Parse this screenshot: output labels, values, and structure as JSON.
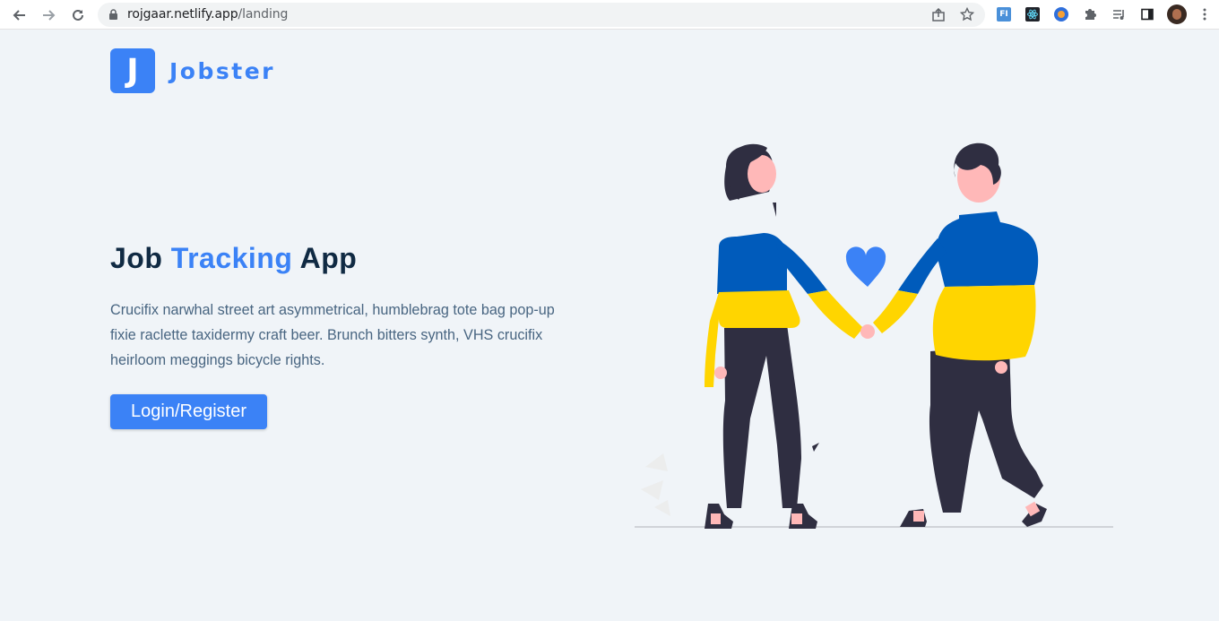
{
  "browser": {
    "url_host": "rojgaar.netlify.app",
    "url_path": "/landing",
    "back_icon": "arrow-left-icon",
    "forward_icon": "arrow-right-icon",
    "reload_icon": "reload-icon",
    "lock_icon": "lock-icon",
    "share_icon": "share-icon",
    "bookmark_icon": "star-icon",
    "extensions": [
      "fi-extension-icon",
      "react-devtools-icon",
      "colorzilla-icon",
      "puzzle-icon",
      "media-icon",
      "sidepanel-icon"
    ],
    "profile_icon": "avatar-icon",
    "menu_icon": "kebab-icon"
  },
  "logo": {
    "letter": "J",
    "name": "Jobster"
  },
  "hero": {
    "title_part1": "Job ",
    "title_accent": "Tracking",
    "title_part2": " App",
    "description": "Crucifix narwhal street art asymmetrical, humblebrag tote bag pop-up fixie raclette taxidermy craft beer. Brunch bitters synth, VHS crucifix heirloom meggings bicycle rights.",
    "cta_label": "Login/Register"
  },
  "colors": {
    "brand": "#3b82f6",
    "background": "#f0f4f8",
    "heading": "#102a43",
    "text": "#486581",
    "flag_blue": "#005bbb",
    "flag_yellow": "#ffd500",
    "dark": "#2f2e41"
  }
}
